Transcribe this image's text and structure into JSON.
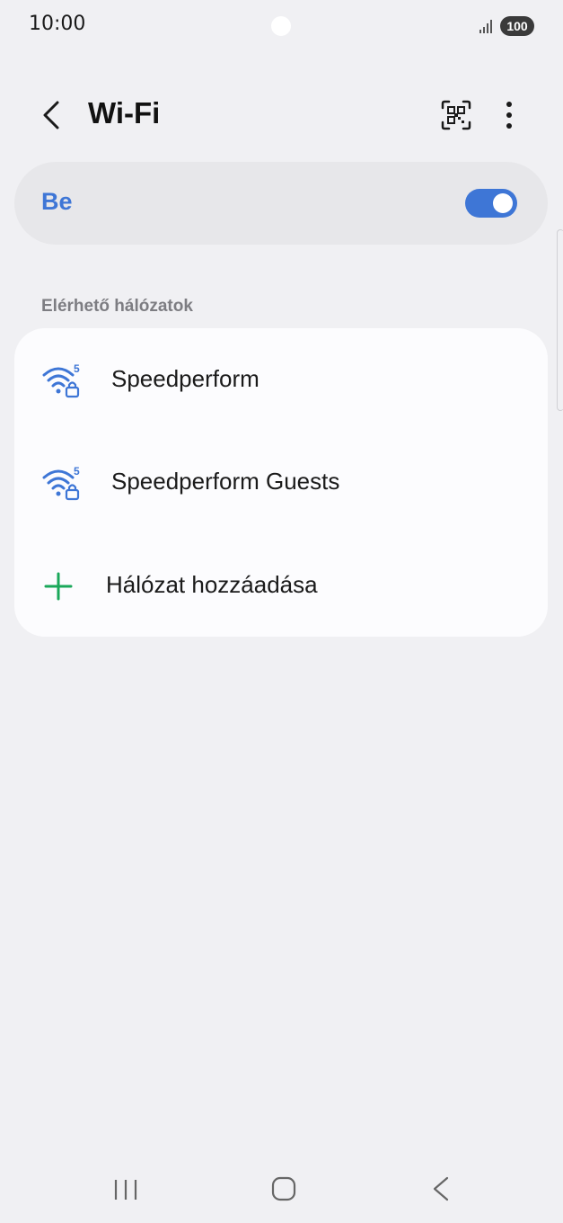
{
  "status_bar": {
    "time": "10:00",
    "battery": "100",
    "icons": [
      "signal-icon",
      "battery-icon"
    ]
  },
  "header": {
    "title": "Wi-Fi",
    "icons": [
      "back-arrow-icon",
      "qr-code-icon",
      "more-vert-icon"
    ]
  },
  "toggle": {
    "label": "Be",
    "state": "on",
    "accent_color": "#3e76d6"
  },
  "section": {
    "title": "Elérhető hálózatok"
  },
  "networks": [
    {
      "name": "Speedperform",
      "icon": "wifi-5ghz-lock-icon"
    },
    {
      "name": "Speedperform Guests",
      "icon": "wifi-5ghz-lock-icon"
    }
  ],
  "add_network": {
    "label": "Hálózat hozzáadása",
    "icon": "plus-icon",
    "icon_color": "#1aa85a"
  },
  "nav_bar": {
    "icons": [
      "recents-icon",
      "home-icon",
      "back-icon"
    ]
  }
}
